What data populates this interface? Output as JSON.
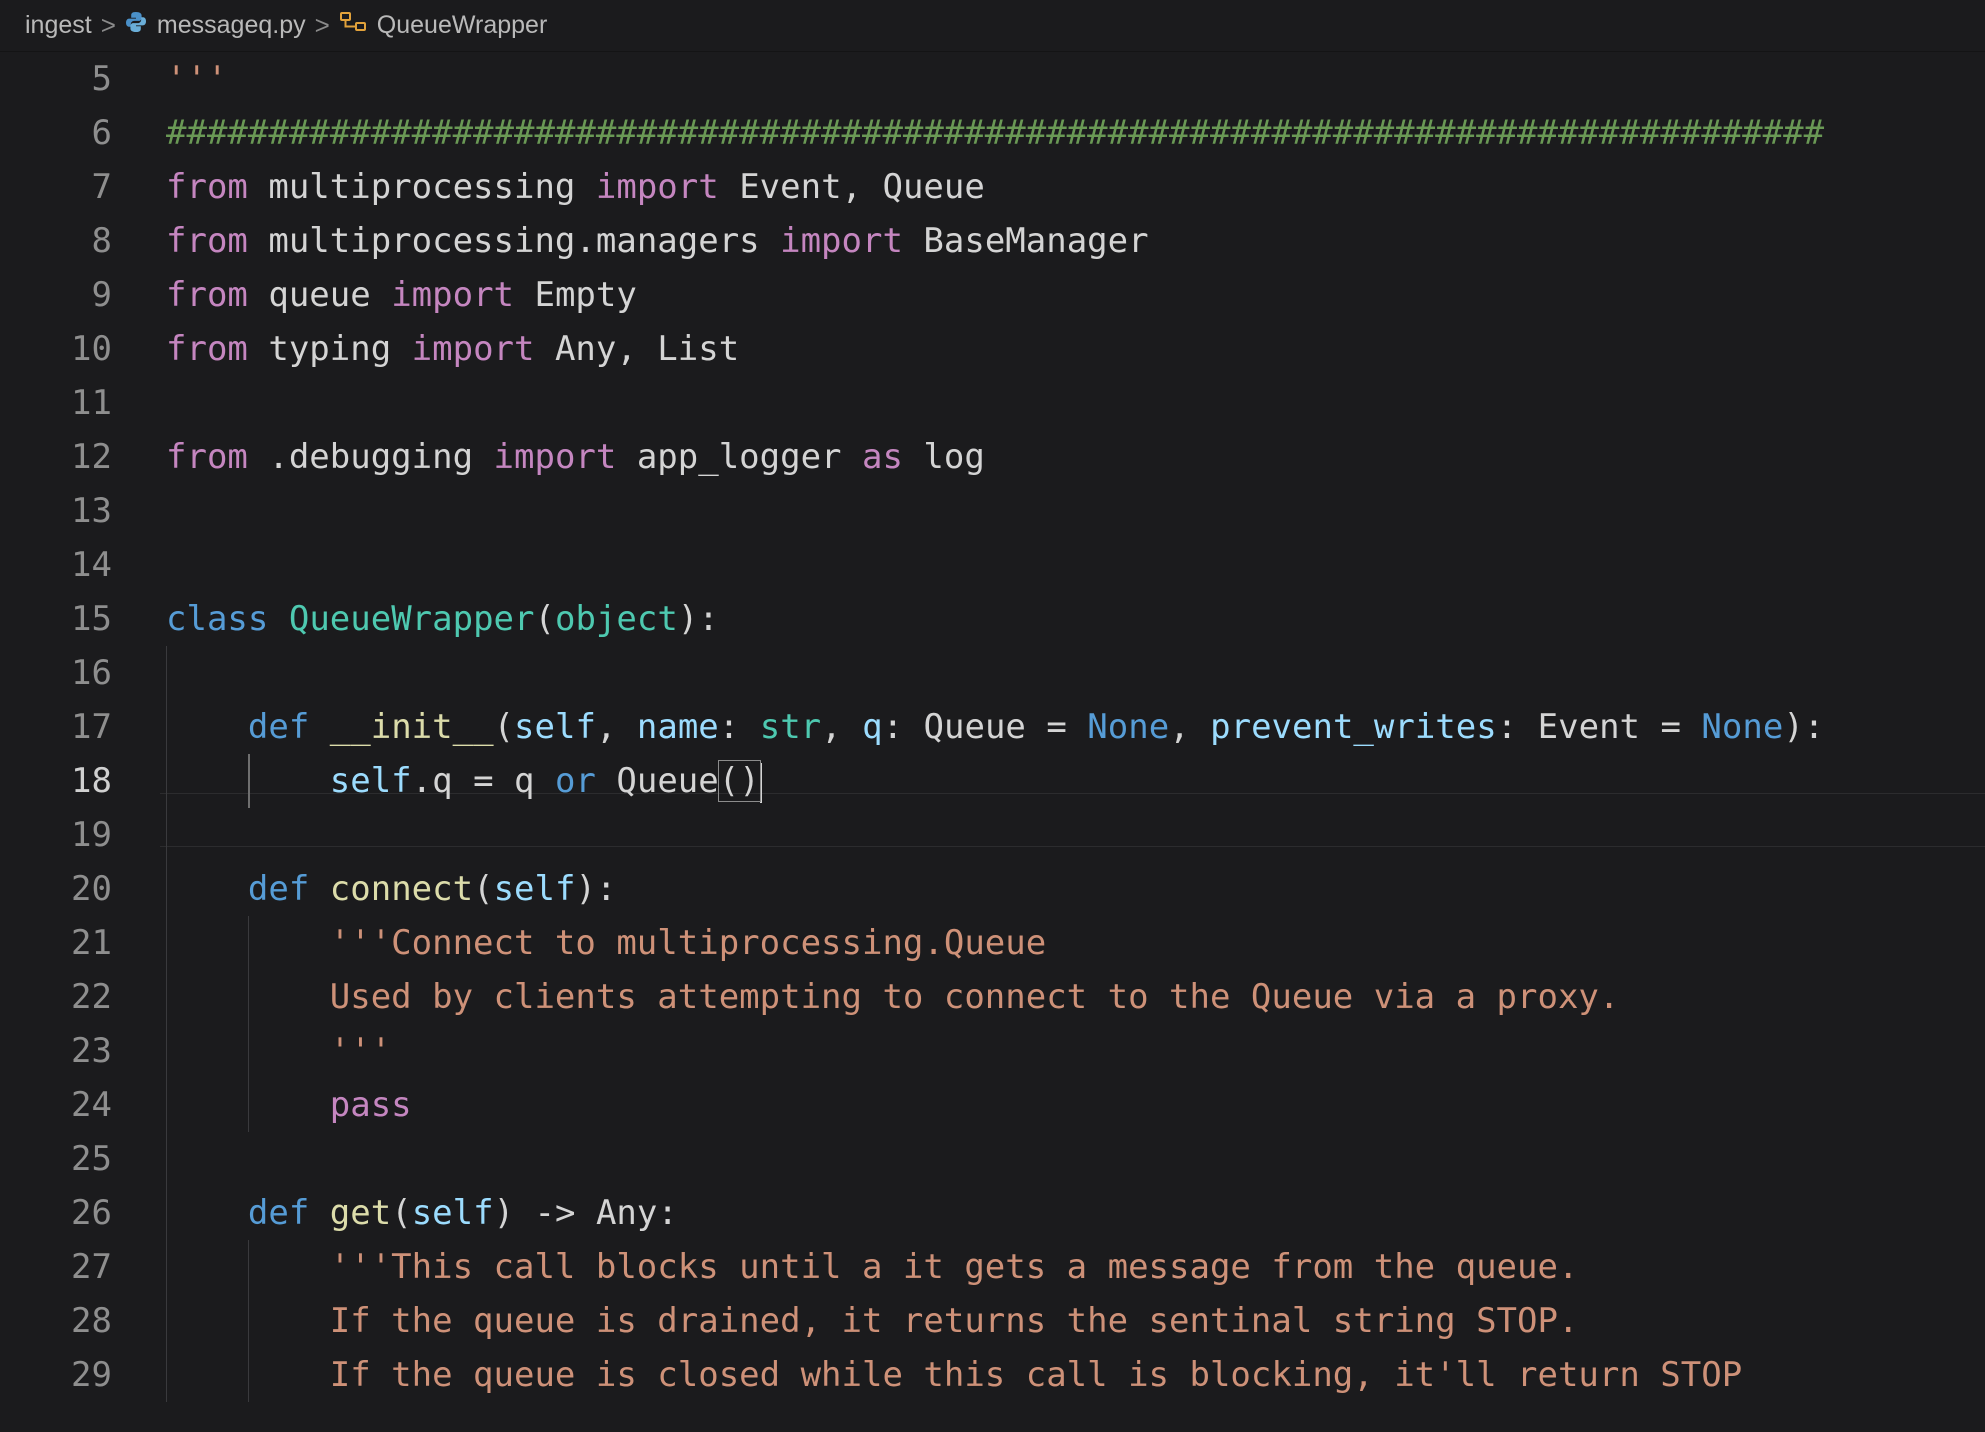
{
  "breadcrumb": {
    "items": [
      {
        "label": "ingest",
        "icon": "none"
      },
      {
        "label": "messageq.py",
        "icon": "python-file-icon"
      },
      {
        "label": "QueueWrapper",
        "icon": "class-symbol-icon"
      }
    ],
    "separator": ">"
  },
  "editor": {
    "language": "python",
    "current_line": 18,
    "lines": [
      {
        "number": "5",
        "tokens": [
          {
            "t": "'''",
            "c": "str"
          }
        ]
      },
      {
        "number": "6",
        "tokens": [
          {
            "t": "#################################################################################",
            "c": "cmt"
          }
        ]
      },
      {
        "number": "7",
        "tokens": [
          {
            "t": "from",
            "c": "kw"
          },
          {
            "t": " multiprocessing ",
            "c": "txt"
          },
          {
            "t": "import",
            "c": "kw"
          },
          {
            "t": " Event, Queue",
            "c": "txt"
          }
        ]
      },
      {
        "number": "8",
        "tokens": [
          {
            "t": "from",
            "c": "kw"
          },
          {
            "t": " multiprocessing.managers ",
            "c": "txt"
          },
          {
            "t": "import",
            "c": "kw"
          },
          {
            "t": " BaseManager",
            "c": "txt"
          }
        ]
      },
      {
        "number": "9",
        "tokens": [
          {
            "t": "from",
            "c": "kw"
          },
          {
            "t": " queue ",
            "c": "txt"
          },
          {
            "t": "import",
            "c": "kw"
          },
          {
            "t": " Empty",
            "c": "txt"
          }
        ]
      },
      {
        "number": "10",
        "tokens": [
          {
            "t": "from",
            "c": "kw"
          },
          {
            "t": " typing ",
            "c": "txt"
          },
          {
            "t": "import",
            "c": "kw"
          },
          {
            "t": " Any, List",
            "c": "txt"
          }
        ]
      },
      {
        "number": "11",
        "tokens": []
      },
      {
        "number": "12",
        "tokens": [
          {
            "t": "from",
            "c": "kw"
          },
          {
            "t": " .debugging ",
            "c": "txt"
          },
          {
            "t": "import",
            "c": "kw"
          },
          {
            "t": " app_logger ",
            "c": "txt"
          },
          {
            "t": "as",
            "c": "kw"
          },
          {
            "t": " log",
            "c": "txt"
          }
        ]
      },
      {
        "number": "13",
        "tokens": []
      },
      {
        "number": "14",
        "tokens": []
      },
      {
        "number": "15",
        "tokens": [
          {
            "t": "class",
            "c": "kwb"
          },
          {
            "t": " ",
            "c": "txt"
          },
          {
            "t": "QueueWrapper",
            "c": "cls"
          },
          {
            "t": "(",
            "c": "txt"
          },
          {
            "t": "object",
            "c": "cls"
          },
          {
            "t": "):",
            "c": "txt"
          }
        ]
      },
      {
        "number": "16",
        "tokens": []
      },
      {
        "number": "17",
        "tokens": [
          {
            "t": "    ",
            "c": "txt"
          },
          {
            "t": "def",
            "c": "kwb"
          },
          {
            "t": " ",
            "c": "txt"
          },
          {
            "t": "__init__",
            "c": "fn"
          },
          {
            "t": "(",
            "c": "txt"
          },
          {
            "t": "self",
            "c": "prm"
          },
          {
            "t": ", ",
            "c": "txt"
          },
          {
            "t": "name",
            "c": "prm"
          },
          {
            "t": ": ",
            "c": "txt"
          },
          {
            "t": "str",
            "c": "cls"
          },
          {
            "t": ", ",
            "c": "txt"
          },
          {
            "t": "q",
            "c": "prm"
          },
          {
            "t": ": Queue = ",
            "c": "txt"
          },
          {
            "t": "None",
            "c": "kwb"
          },
          {
            "t": ", ",
            "c": "txt"
          },
          {
            "t": "prevent_writes",
            "c": "prm"
          },
          {
            "t": ": Event = ",
            "c": "txt"
          },
          {
            "t": "None",
            "c": "kwb"
          },
          {
            "t": "):",
            "c": "txt"
          }
        ]
      },
      {
        "number": "18",
        "tokens": [
          {
            "t": "        ",
            "c": "txt"
          },
          {
            "t": "self",
            "c": "prm"
          },
          {
            "t": ".q = q ",
            "c": "txt"
          },
          {
            "t": "or",
            "c": "kwb"
          },
          {
            "t": " Queue",
            "c": "txt"
          },
          {
            "t": "()",
            "c": "txt",
            "b": "bracket"
          }
        ]
      },
      {
        "number": "19",
        "tokens": []
      },
      {
        "number": "20",
        "tokens": [
          {
            "t": "    ",
            "c": "txt"
          },
          {
            "t": "def",
            "c": "kwb"
          },
          {
            "t": " ",
            "c": "txt"
          },
          {
            "t": "connect",
            "c": "fn"
          },
          {
            "t": "(",
            "c": "txt"
          },
          {
            "t": "self",
            "c": "prm"
          },
          {
            "t": "):",
            "c": "txt"
          }
        ]
      },
      {
        "number": "21",
        "tokens": [
          {
            "t": "        ",
            "c": "txt"
          },
          {
            "t": "'''Connect to multiprocessing.Queue",
            "c": "str"
          }
        ]
      },
      {
        "number": "22",
        "tokens": [
          {
            "t": "        ",
            "c": "txt"
          },
          {
            "t": "Used by clients attempting to connect to the Queue via a proxy.",
            "c": "str"
          }
        ]
      },
      {
        "number": "23",
        "tokens": [
          {
            "t": "        ",
            "c": "txt"
          },
          {
            "t": "'''",
            "c": "str"
          }
        ]
      },
      {
        "number": "24",
        "tokens": [
          {
            "t": "        ",
            "c": "txt"
          },
          {
            "t": "pass",
            "c": "kw"
          }
        ]
      },
      {
        "number": "25",
        "tokens": []
      },
      {
        "number": "26",
        "tokens": [
          {
            "t": "    ",
            "c": "txt"
          },
          {
            "t": "def",
            "c": "kwb"
          },
          {
            "t": " ",
            "c": "txt"
          },
          {
            "t": "get",
            "c": "fn"
          },
          {
            "t": "(",
            "c": "txt"
          },
          {
            "t": "self",
            "c": "prm"
          },
          {
            "t": ") -> Any:",
            "c": "txt"
          }
        ]
      },
      {
        "number": "27",
        "tokens": [
          {
            "t": "        ",
            "c": "txt"
          },
          {
            "t": "'''This call blocks until a it gets a message from the queue.",
            "c": "str"
          }
        ]
      },
      {
        "number": "28",
        "tokens": [
          {
            "t": "        ",
            "c": "txt"
          },
          {
            "t": "If the queue is drained, it returns the sentinal string STOP.",
            "c": "str"
          }
        ]
      },
      {
        "number": "29",
        "tokens": [
          {
            "t": "        ",
            "c": "txt"
          },
          {
            "t": "If the queue is closed while this call is blocking, it'll return STOP",
            "c": "str"
          }
        ]
      }
    ]
  }
}
